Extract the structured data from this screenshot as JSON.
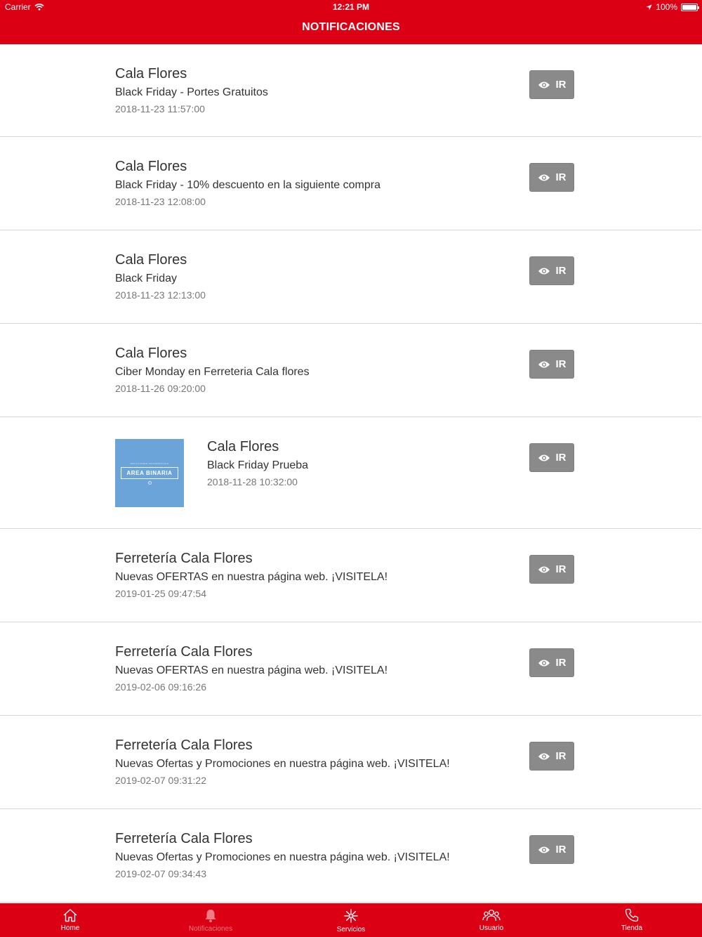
{
  "status_bar": {
    "carrier": "Carrier",
    "time": "12:21 PM",
    "battery": "100%"
  },
  "header": {
    "title": "NOTIFICACIONES"
  },
  "colors": {
    "brand_red": "#dc0014",
    "button_gray": "#8a8a8a",
    "inactive_tab": "#f07b86"
  },
  "notifications": [
    {
      "sender": "Cala Flores",
      "message": "Black Friday - Portes Gratuitos",
      "date": "2018-11-23 11:57:00",
      "button": "IR"
    },
    {
      "sender": "Cala Flores",
      "message": "Black Friday - 10% descuento en la siguiente compra",
      "date": "2018-11-23 12:08:00",
      "button": "IR"
    },
    {
      "sender": "Cala Flores",
      "message": "Black Friday",
      "date": "2018-11-23 12:13:00",
      "button": "IR"
    },
    {
      "sender": "Cala Flores",
      "message": "Ciber Monday en Ferreteria Cala flores",
      "date": "2018-11-26 09:20:00",
      "button": "IR"
    },
    {
      "sender": "Cala Flores",
      "message": "Black Friday Prueba",
      "date": "2018-11-28 10:32:00",
      "button": "IR",
      "image": {
        "caption": "SOLUCIONES INFORMÁTICAS",
        "logo_text": "AREA BINARIA"
      }
    },
    {
      "sender": "Ferretería Cala Flores",
      "message": "Nuevas OFERTAS en nuestra página web. ¡VISITELA!",
      "date": "2019-01-25 09:47:54",
      "button": "IR"
    },
    {
      "sender": "Ferretería Cala Flores",
      "message": "Nuevas OFERTAS en nuestra página web. ¡VISITELA!",
      "date": "2019-02-06 09:16:26",
      "button": "IR"
    },
    {
      "sender": "Ferretería Cala Flores",
      "message": "Nuevas Ofertas y Promociones en nuestra página web. ¡VISITELA!",
      "date": "2019-02-07 09:31:22",
      "button": "IR"
    },
    {
      "sender": "Ferretería Cala Flores",
      "message": "Nuevas Ofertas y Promociones en nuestra página web. ¡VISITELA!",
      "date": "2019-02-07 09:34:43",
      "button": "IR"
    }
  ],
  "tabbar": {
    "tabs": [
      {
        "label": "Home",
        "icon": "home-icon",
        "active": true
      },
      {
        "label": "Notificaciones",
        "icon": "bell-icon",
        "active": false
      },
      {
        "label": "Servicios",
        "icon": "asterisk-icon",
        "active": true
      },
      {
        "label": "Usuario",
        "icon": "users-icon",
        "active": true
      },
      {
        "label": "Tienda",
        "icon": "phone-icon",
        "active": true
      }
    ]
  }
}
